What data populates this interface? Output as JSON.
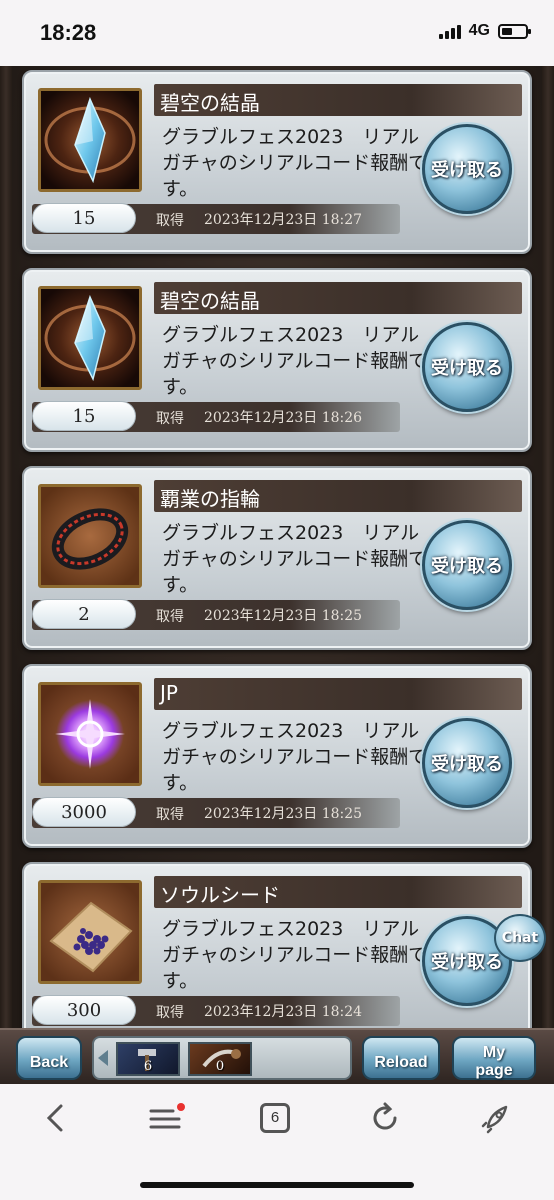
{
  "status": {
    "time": "18:28",
    "network": "4G"
  },
  "rewards": [
    {
      "title": "碧空の結晶",
      "description": "グラブルフェス2023　リアルガチャのシリアルコード報酬です。",
      "quantity": "15",
      "acquired_label": "取得",
      "date": "2023年12月23日 18:27",
      "button_label": "受け取る",
      "icon": "crystal-icon"
    },
    {
      "title": "碧空の結晶",
      "description": "グラブルフェス2023　リアルガチャのシリアルコード報酬です。",
      "quantity": "15",
      "acquired_label": "取得",
      "date": "2023年12月23日 18:26",
      "button_label": "受け取る",
      "icon": "crystal-icon"
    },
    {
      "title": "覇業の指輪",
      "description": "グラブルフェス2023　リアルガチャのシリアルコード報酬です。",
      "quantity": "2",
      "acquired_label": "取得",
      "date": "2023年12月23日 18:25",
      "button_label": "受け取る",
      "icon": "ring-icon"
    },
    {
      "title": "JP",
      "description": "グラブルフェス2023　リアルガチャのシリアルコード報酬です。",
      "quantity": "3000",
      "acquired_label": "取得",
      "date": "2023年12月23日 18:25",
      "button_label": "受け取る",
      "icon": "jp-orb-icon"
    },
    {
      "title": "ソウルシード",
      "description": "グラブルフェス2023　リアルガチャのシリアルコード報酬です。",
      "quantity": "300",
      "acquired_label": "取得",
      "date": "2023年12月23日 18:24",
      "button_label": "受け取る",
      "icon": "soul-seed-icon"
    }
  ],
  "chat_label": "Chat",
  "game_nav": {
    "back_label": "Back",
    "reload_label": "Reload",
    "mypage_line1": "My",
    "mypage_line2": "page",
    "strip_items": [
      {
        "icon": "hammer-icon",
        "count": "6"
      },
      {
        "icon": "weapon-icon",
        "count": "0"
      }
    ]
  },
  "browser": {
    "tab_count": "6"
  },
  "colors": {
    "title_bar": "#3b2f29",
    "button_blue": "#8fc4dc",
    "notification_dot": "#e8312f"
  }
}
